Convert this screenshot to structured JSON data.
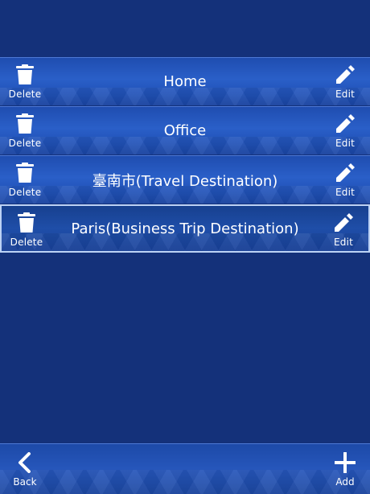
{
  "colors": {
    "background": "#14317a",
    "row_gradient": "#2a5fc8",
    "selected_border": "#bcd2f5",
    "text": "#ffffff"
  },
  "rows": [
    {
      "title": "Home",
      "delete_label": "Delete",
      "edit_label": "Edit",
      "selected": false
    },
    {
      "title": "Office",
      "delete_label": "Delete",
      "edit_label": "Edit",
      "selected": false
    },
    {
      "title": "臺南市(Travel Destination)",
      "delete_label": "Delete",
      "edit_label": "Edit",
      "selected": false
    },
    {
      "title": "Paris(Business Trip Destination)",
      "delete_label": "Delete",
      "edit_label": "Edit",
      "selected": true
    }
  ],
  "bottom_bar": {
    "back_label": "Back",
    "back_icon": "chevron-left-icon",
    "add_label": "Add",
    "add_icon": "plus-icon"
  }
}
